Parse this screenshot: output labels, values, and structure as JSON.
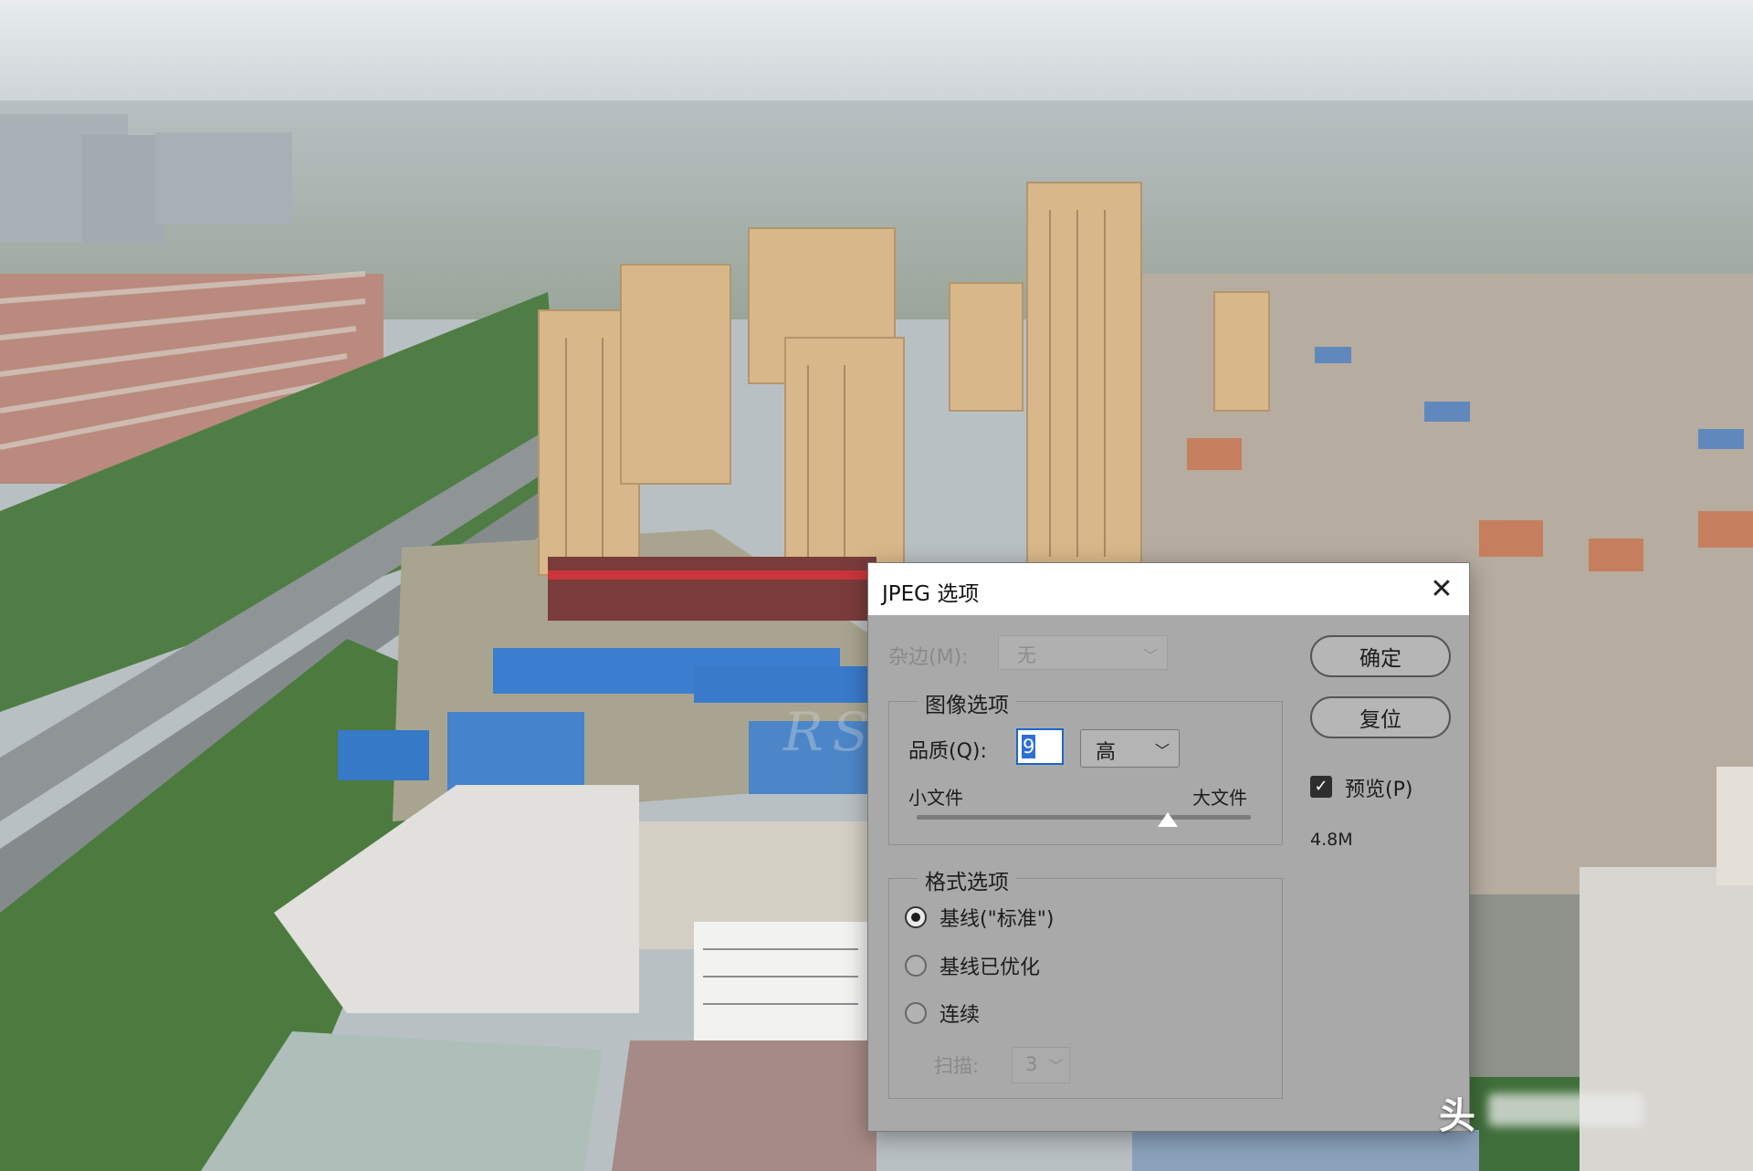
{
  "dialog": {
    "title": "JPEG 选项",
    "close_glyph": "✕",
    "matte_label": "杂边(M):",
    "matte_value": "无",
    "image_options_title": "图像选项",
    "quality_label": "品质(Q):",
    "quality_value": "9",
    "quality_level": "高",
    "small_file_label": "小文件",
    "large_file_label": "大文件",
    "slider_value_fraction": 0.75,
    "ok_button": "确定",
    "reset_button": "复位",
    "preview_label": "预览(P)",
    "preview_checked": true,
    "file_size": "4.8M",
    "format_options_title": "格式选项",
    "format_options": [
      {
        "label": "基线(\"标准\")",
        "selected": true
      },
      {
        "label": "基线已优化",
        "selected": false
      },
      {
        "label": "连续",
        "selected": false
      }
    ],
    "scan_label": "扫描:",
    "scan_value": "3",
    "dropdown_icon": "chevron-down-icon"
  },
  "watermarks": {
    "center_text": "RSJ",
    "corner_text": "头"
  },
  "colors": {
    "dialog_bg": "#a9a9a9",
    "titlebar_bg": "#ffffff",
    "focus_blue": "#2d6fd6"
  }
}
